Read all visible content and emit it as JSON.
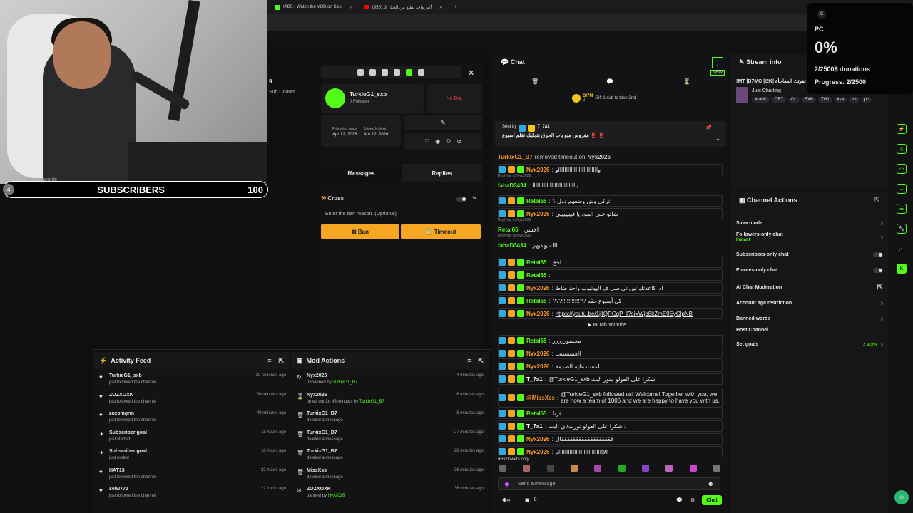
{
  "browser": {
    "tabs": [
      {
        "title": "IABS - Watch the VOD on Kick"
      },
      {
        "title": "أكبر واحد يطلع من الجبل الـ (955)"
      }
    ]
  },
  "overlay": {
    "drops_label": "Drops & rewards",
    "subs_circle": "4",
    "subs_label": "SUBSCRIBERS",
    "subs_value": "100"
  },
  "donation": {
    "badge": "C",
    "label": "PC",
    "percent": "0%",
    "amount": "2/2500$ donations",
    "progress": "Progress: 2/2500",
    "progress_fraction": 0.0008
  },
  "left_stats": {
    "value": "9",
    "label": "Sub Counts"
  },
  "user_card": {
    "username": "TurkleG1_sxb",
    "followers": "0 Follower",
    "bio": "No Bio.",
    "following_label": "Following since",
    "following_date": "Apr 12, 2026",
    "joined_label": "Joined Kick At",
    "joined_date": "Apr 12, 2026",
    "tab_messages": "Messages",
    "tab_replies": "Replies",
    "cross_label": "Cross",
    "ban_placeholder": "Enter the ban reason. (Optional)",
    "ban_button": "Ban",
    "timeout_button": "Timeout"
  },
  "chat": {
    "title": "Chat",
    "new_badge": "NEW",
    "gift_user": "DI7M",
    "gift_count": "2",
    "gift_text": "Gift 1 sub to take 2nd",
    "sent_by_label": "Sent by",
    "sent_by_user": "T_7a1",
    "pinned_text": "مفروض منع بات الحرق بتجليك تقلم أسبوع ‼️ ‼️",
    "system_user": "TurkixG1_B7",
    "system_text": "removed timeout on",
    "system_target": "Nyx2026",
    "messages": [
      {
        "user": "Nyx2026",
        "text": "واااااااااااااااااااااااااو",
        "color": "#ff9b28"
      },
      {
        "reply": "Replying to Nyx2026:",
        "user": "fahaD3434",
        "text": "ياااااااااااااااااااااااااااا",
        "color": "#53fc18"
      },
      {
        "user": "Retal65",
        "text": "تركي وش وضعهم دول ؟",
        "color": "#53fc18"
      },
      {
        "user": "Nyx2026",
        "text": "شالو علي المود يا فيييييييي",
        "color": "#ff9b28"
      },
      {
        "reply": "Replying to Nyx2026:",
        "user": "Retal65",
        "text": "احسن",
        "color": "#53fc18"
      },
      {
        "reply": "Replying to Nyx2026:",
        "user": "fahaD3434",
        "text": "الله يهديهم",
        "color": "#53fc18"
      },
      {
        "user": "Retal65",
        "text": "احح",
        "color": "#53fc18"
      },
      {
        "user": "Retal65",
        "text": "",
        "color": "#53fc18"
      },
      {
        "user": "Nyx2026",
        "text": "اذا كاعدتك لين تي سي ف اليوتيوب واحد ضاط",
        "color": "#ff9b28"
      },
      {
        "user": "Retal65",
        "text": "???!!!!!!!!!!!?? كل أسبوع حقه",
        "color": "#53fc18"
      },
      {
        "user": "Nyx2026",
        "text": "https://youtu.be/1jlIQRCqP_I?si=Wjb8kZmE9EyClpNB",
        "color": "#ff9b28"
      },
      {
        "user": "Retal65",
        "text": "محضوررررر",
        "color": "#53fc18"
      },
      {
        "user": "Nyx2026",
        "text": "العببببببببب",
        "color": "#ff9b28"
      },
      {
        "user": "Nyx2026",
        "text": "لمفت عليه الصدمة",
        "color": "#ff9b28"
      },
      {
        "user": "T_7a1",
        "text": "@TurkieG1_sxb شكرا على الفولو منور البث",
        "color": "#ffffff"
      },
      {
        "user": "@MissXss",
        "text": "@TurkieG1_sxb followed us! Welcome! Together with you, we are now a team of 1006 and we are happy to have you with us.",
        "color": "#ff9b28"
      },
      {
        "user": "Retal65",
        "text": "قرنا",
        "color": "#53fc18"
      },
      {
        "user": "T_7a1",
        "text": "شكرا على الفولو نورت/اي البث :",
        "color": "#ffffff"
      },
      {
        "user": "Nyx2026",
        "text": "ققققققققققققققققققال",
        "color": "#ff9b28"
      },
      {
        "user": "Nyx2026",
        "text": "الاااااااااااااااااااااااااااااه",
        "color": "#ff9b28"
      }
    ],
    "intab_label": "In-Tab Youtube",
    "followers_only": "Followers only",
    "input_placeholder": "Send a message",
    "viewer_count": "0",
    "chat_button": "Chat"
  },
  "stream_info": {
    "title": "Stream info",
    "stream_title": "!MT |B7MC |I2K| لا تفوتك المفاجأة",
    "category": "Just Chatting",
    "tags": [
      "Arabic",
      "DR7",
      "OL",
      "SXB",
      "TG1",
      "ksa",
      "mt",
      "pc"
    ]
  },
  "channel_actions": {
    "title": "Channel Actions",
    "items": [
      {
        "label": "Slow mode"
      },
      {
        "label": "Followers-only chat",
        "sub": "Instant"
      },
      {
        "label": "Subscribers-only chat"
      },
      {
        "label": "Emotes-only chat"
      },
      {
        "label": "AI Chat Moderation"
      },
      {
        "label": "Account age restriction"
      },
      {
        "label": "Banned words"
      },
      {
        "label": "Host Channel"
      },
      {
        "label": "Set goals",
        "sub": "2 active"
      }
    ]
  },
  "activity_feed": {
    "title": "Activity Feed",
    "items": [
      {
        "name": "TurkieG1_sxb",
        "desc": "just followed the channel",
        "time": "29 seconds ago"
      },
      {
        "name": "ZOZXOXK",
        "desc": "just followed the channel",
        "time": "36 minutes ago"
      },
      {
        "name": "zozomgrm",
        "desc": "just followed the channel",
        "time": "49 minutes ago"
      },
      {
        "name": "Subscriber goal",
        "desc": "just started",
        "time": "18 hours ago"
      },
      {
        "name": "Subscriber goal",
        "desc": "just ended",
        "time": "18 hours ago"
      },
      {
        "name": "HAT13",
        "desc": "just followed the channel",
        "time": "22 hours ago"
      },
      {
        "name": "selw771",
        "desc": "just followed the channel",
        "time": "22 hours ago"
      }
    ]
  },
  "mod_actions": {
    "title": "Mod Actions",
    "items": [
      {
        "name": "Nyx2026",
        "desc": "unbanned by",
        "by": "TurkixG1_B7",
        "time": "4 minutes ago"
      },
      {
        "name": "Nyx2026",
        "desc": "timed out for 45 minutes by",
        "by": "TurkixG1_B7",
        "time": "6 minutes ago"
      },
      {
        "name": "TurkixG1_B7",
        "desc": "deleted a message",
        "by": "",
        "time": "8 minutes ago"
      },
      {
        "name": "TurkixG1_B7",
        "desc": "deleted a message",
        "by": "",
        "time": "27 minutes ago"
      },
      {
        "name": "TurkixG1_B7",
        "desc": "deleted a message",
        "by": "",
        "time": "28 minutes ago"
      },
      {
        "name": "MissXss",
        "desc": "deleted a message",
        "by": "",
        "time": "36 minutes ago"
      },
      {
        "name": "ZOZXOXK",
        "desc": "banned by",
        "by": "Nyx2026",
        "time": "36 minutes ago"
      }
    ]
  }
}
